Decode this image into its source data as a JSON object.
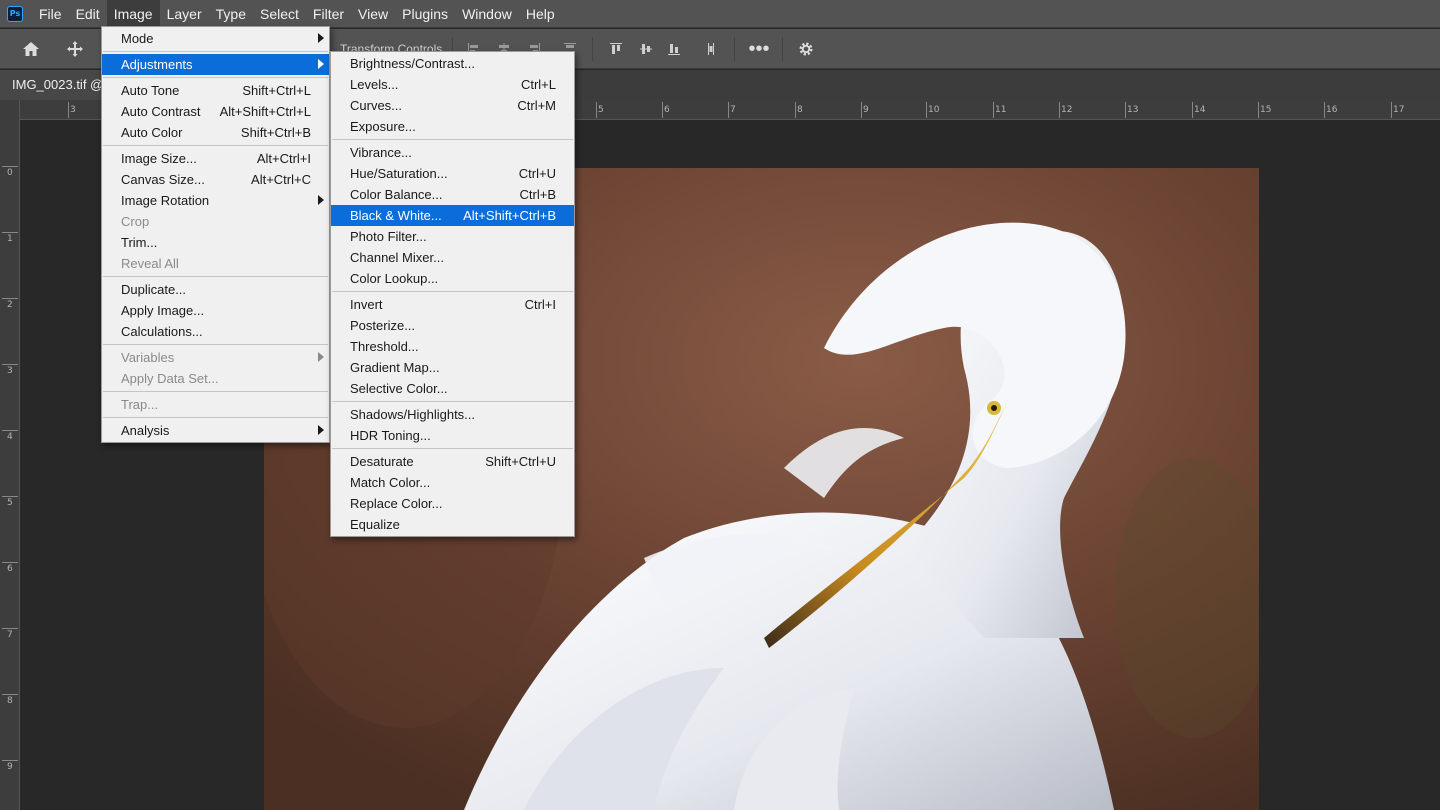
{
  "app": {
    "logo_text": "Ps"
  },
  "menubar": {
    "items": [
      "File",
      "Edit",
      "Image",
      "Layer",
      "Type",
      "Select",
      "Filter",
      "View",
      "Plugins",
      "Window",
      "Help"
    ],
    "active": "Image"
  },
  "options_bar": {
    "transform_controls_label": "Transform Controls"
  },
  "document": {
    "tab_label": "IMG_0023.tif @"
  },
  "rulers": {
    "top": [
      "3",
      "5",
      "6",
      "7",
      "8",
      "9",
      "10",
      "11",
      "12",
      "13",
      "14",
      "15",
      "16",
      "17"
    ],
    "left": [
      "0",
      "1",
      "2",
      "3",
      "4",
      "5",
      "6",
      "7",
      "8",
      "9"
    ]
  },
  "image_menu": {
    "items": [
      {
        "label": "Mode",
        "submenu": true
      },
      {
        "divider": true
      },
      {
        "label": "Adjustments",
        "submenu": true,
        "highlighted": true
      },
      {
        "divider": true
      },
      {
        "label": "Auto Tone",
        "shortcut": "Shift+Ctrl+L"
      },
      {
        "label": "Auto Contrast",
        "shortcut": "Alt+Shift+Ctrl+L"
      },
      {
        "label": "Auto Color",
        "shortcut": "Shift+Ctrl+B"
      },
      {
        "divider": true
      },
      {
        "label": "Image Size...",
        "shortcut": "Alt+Ctrl+I"
      },
      {
        "label": "Canvas Size...",
        "shortcut": "Alt+Ctrl+C"
      },
      {
        "label": "Image Rotation",
        "submenu": true
      },
      {
        "label": "Crop",
        "disabled": true
      },
      {
        "label": "Trim..."
      },
      {
        "label": "Reveal All",
        "disabled": true
      },
      {
        "divider": true
      },
      {
        "label": "Duplicate..."
      },
      {
        "label": "Apply Image..."
      },
      {
        "label": "Calculations..."
      },
      {
        "divider": true
      },
      {
        "label": "Variables",
        "submenu": true,
        "disabled": true
      },
      {
        "label": "Apply Data Set...",
        "disabled": true
      },
      {
        "divider": true
      },
      {
        "label": "Trap...",
        "disabled": true
      },
      {
        "divider": true
      },
      {
        "label": "Analysis",
        "submenu": true
      }
    ]
  },
  "adjustments_menu": {
    "items": [
      {
        "label": "Brightness/Contrast..."
      },
      {
        "label": "Levels...",
        "shortcut": "Ctrl+L"
      },
      {
        "label": "Curves...",
        "shortcut": "Ctrl+M"
      },
      {
        "label": "Exposure..."
      },
      {
        "divider": true
      },
      {
        "label": "Vibrance..."
      },
      {
        "label": "Hue/Saturation...",
        "shortcut": "Ctrl+U"
      },
      {
        "label": "Color Balance...",
        "shortcut": "Ctrl+B"
      },
      {
        "label": "Black & White...",
        "shortcut": "Alt+Shift+Ctrl+B",
        "highlighted": true
      },
      {
        "label": "Photo Filter..."
      },
      {
        "label": "Channel Mixer..."
      },
      {
        "label": "Color Lookup..."
      },
      {
        "divider": true
      },
      {
        "label": "Invert",
        "shortcut": "Ctrl+I"
      },
      {
        "label": "Posterize..."
      },
      {
        "label": "Threshold..."
      },
      {
        "label": "Gradient Map..."
      },
      {
        "label": "Selective Color..."
      },
      {
        "divider": true
      },
      {
        "label": "Shadows/Highlights..."
      },
      {
        "label": "HDR Toning..."
      },
      {
        "divider": true
      },
      {
        "label": "Desaturate",
        "shortcut": "Shift+Ctrl+U"
      },
      {
        "label": "Match Color..."
      },
      {
        "label": "Replace Color..."
      },
      {
        "label": "Equalize"
      }
    ]
  },
  "colors": {
    "highlight": "#0a6dd9",
    "menu_bg": "#f0f0f0",
    "chrome": "#535353"
  }
}
